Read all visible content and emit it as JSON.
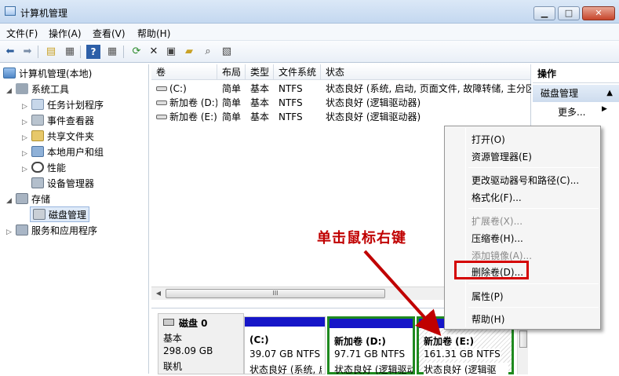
{
  "window": {
    "title": "计算机管理",
    "controls": {
      "minimize": "▁",
      "maximize": "□",
      "close": "✕"
    }
  },
  "menu": [
    "文件(F)",
    "操作(A)",
    "查看(V)",
    "帮助(H)"
  ],
  "toolbar": {
    "icons": [
      "back-arrow-icon",
      "forward-arrow-icon",
      "up-folder-icon",
      "show-tree-icon",
      "help-icon",
      "console-icon",
      "refresh-icon",
      "delete-icon",
      "properties-icon",
      "open-folder-icon",
      "search-icon",
      "export-icon"
    ]
  },
  "tree": {
    "root": "计算机管理(本地)",
    "system_tools": "系统工具",
    "task_scheduler": "任务计划程序",
    "event_viewer": "事件查看器",
    "shared_folders": "共享文件夹",
    "local_users": "本地用户和组",
    "performance": "性能",
    "device_manager": "设备管理器",
    "storage": "存储",
    "disk_management": "磁盘管理",
    "services_apps": "服务和应用程序"
  },
  "volumes": {
    "headers": [
      "卷",
      "布局",
      "类型",
      "文件系统",
      "状态"
    ],
    "rows": [
      {
        "name": "(C:)",
        "layout": "简单",
        "type": "基本",
        "fs": "NTFS",
        "status": "状态良好 (系统, 启动, 页面文件, 故障转储, 主分区)"
      },
      {
        "name": "新加卷 (D:)",
        "layout": "简单",
        "type": "基本",
        "fs": "NTFS",
        "status": "状态良好 (逻辑驱动器)"
      },
      {
        "name": "新加卷 (E:)",
        "layout": "简单",
        "type": "基本",
        "fs": "NTFS",
        "status": "状态良好 (逻辑驱动器)"
      }
    ]
  },
  "scrollbar": {
    "thumb_glyph": "III",
    "left_arrow": "◀"
  },
  "disk": {
    "name": "磁盘 0",
    "type": "基本",
    "size": "298.09 GB",
    "status": "联机",
    "partitions": [
      {
        "label": "(C:)",
        "size": "39.07 GB NTFS",
        "status": "状态良好 (系统, 启"
      },
      {
        "label": "新加卷  (D:)",
        "size": "97.71 GB NTFS",
        "status": "状态良好 (逻辑驱动"
      },
      {
        "label": "新加卷  (E:)",
        "size": "161.31 GB NTFS",
        "status": "状态良好 (逻辑驱"
      }
    ]
  },
  "actions": {
    "title": "操作",
    "section": "磁盘管理",
    "more": "更多..."
  },
  "context_menu": {
    "open": "打开(O)",
    "explorer": "资源管理器(E)",
    "change_letter": "更改驱动器号和路径(C)...",
    "format": "格式化(F)...",
    "extend": "扩展卷(X)...",
    "shrink": "压缩卷(H)...",
    "add_mirror": "添加镜像(A)...",
    "delete": "删除卷(D)...",
    "properties": "属性(P)",
    "help": "帮助(H)"
  },
  "annotation": "单击鼠标右键",
  "colors": {
    "annotation": "#c00000",
    "partition_bar": "#1616c8",
    "selected_partition_border": "#1f8a1f",
    "highlight_box": "#d40000"
  }
}
